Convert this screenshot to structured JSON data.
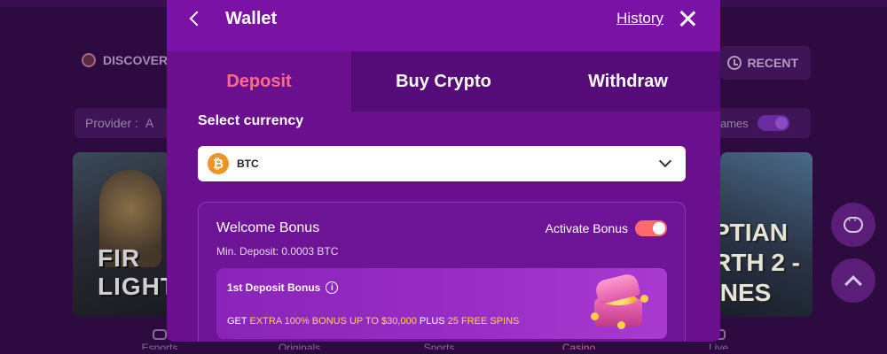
{
  "background": {
    "discover_label": "DISCOVER",
    "recent_label": "RECENT",
    "provider_label": "Provider :",
    "provider_value": "A",
    "games_label": "ames",
    "card_left_text": "FIR\nLIGHT",
    "card_right_text": "PTIAN\nRTH 2 -\nINES",
    "nav": [
      "Esports",
      "Originals",
      "Sports",
      "Casino",
      "Live"
    ]
  },
  "wallet": {
    "title": "Wallet",
    "history_link": "History",
    "tabs": [
      {
        "label": "Deposit",
        "active": true
      },
      {
        "label": "Buy Crypto",
        "active": false
      },
      {
        "label": "Withdraw",
        "active": false
      }
    ],
    "select_currency_label": "Select currency",
    "currency": {
      "symbol": "₿",
      "code": "BTC"
    },
    "bonus": {
      "title": "Welcome Bonus",
      "activate_label": "Activate Bonus",
      "activated": true,
      "min_deposit": "Min. Deposit: 0.0003 BTC",
      "promo_title": "1st Deposit Bonus",
      "promo_get": "GET ",
      "promo_extra": "EXTRA 100% BONUS UP TO $30,000",
      "promo_plus": " PLUS ",
      "promo_spins": "25 FREE SPINS"
    }
  },
  "colors": {
    "modal_bg": "#6a0f8e",
    "active_tab": "#ff6b8a",
    "toggle_on": "#ff6b6b",
    "highlight": "#ffd84a",
    "btc": "#f29224"
  }
}
